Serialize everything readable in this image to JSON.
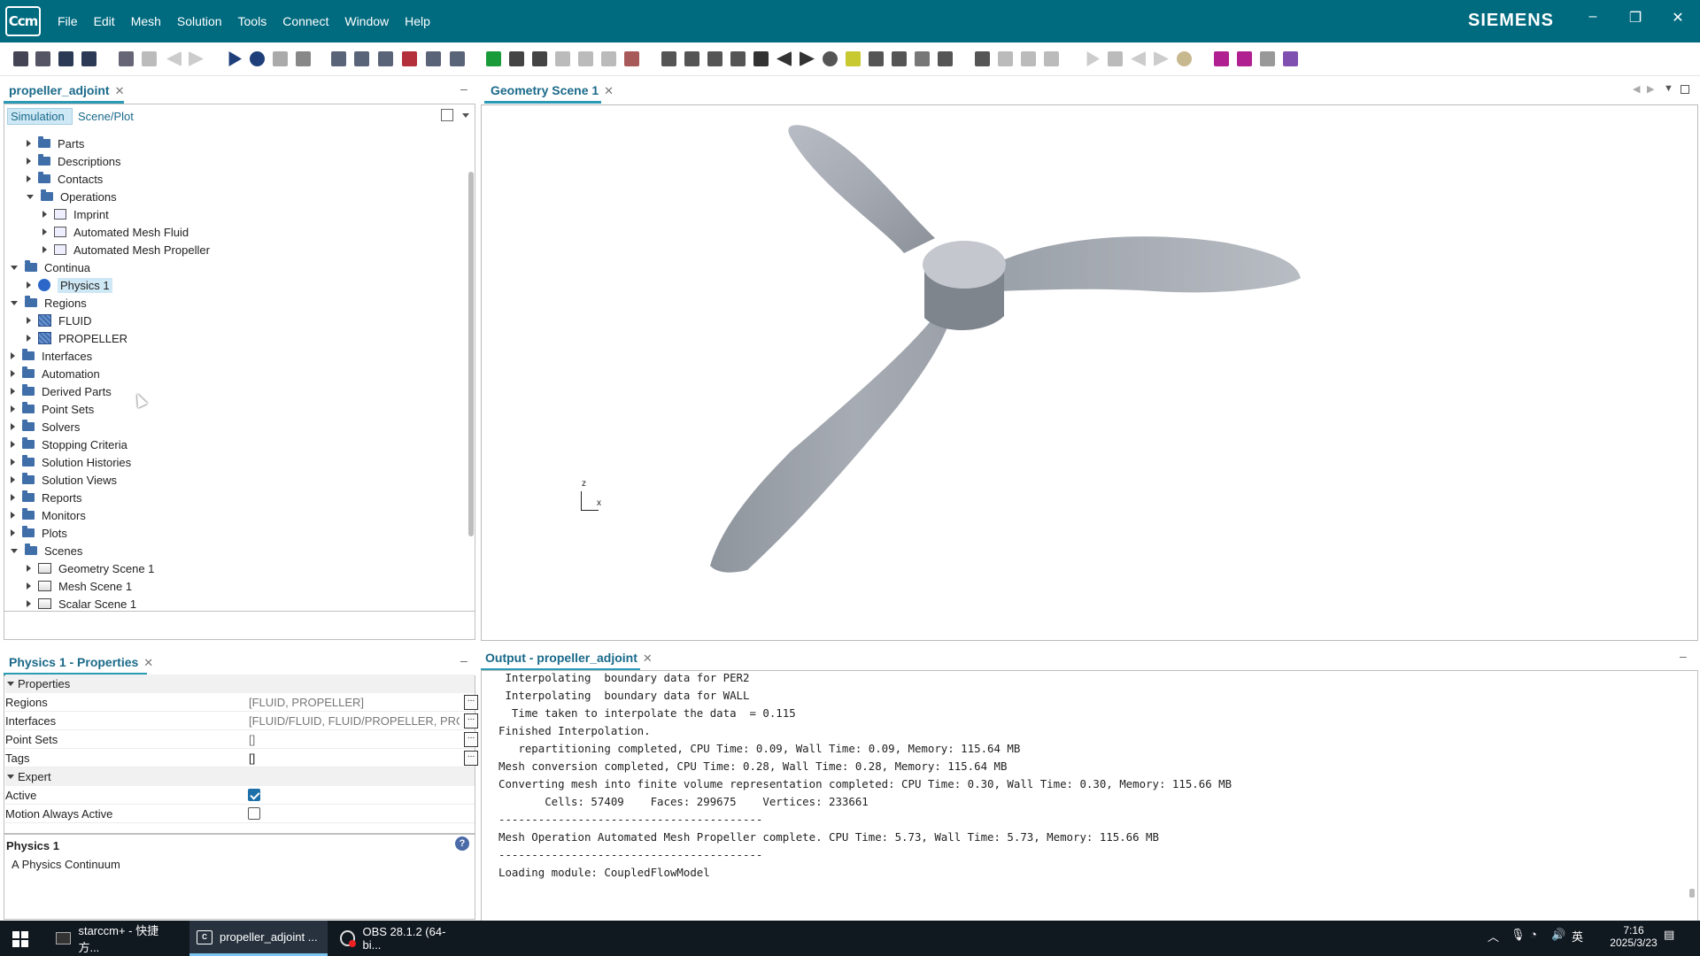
{
  "app": {
    "logo": "Ccm",
    "brand": "SIEMENS",
    "menu": [
      "File",
      "Edit",
      "Mesh",
      "Solution",
      "Tools",
      "Connect",
      "Window",
      "Help"
    ],
    "window_buttons": {
      "minimize": "–",
      "restore": "❐",
      "close": "✕"
    }
  },
  "left_panel": {
    "tab": "propeller_adjoint",
    "subtabs": [
      "Simulation",
      "Scene/Plot"
    ],
    "tree": [
      {
        "label": "Parts",
        "level": 1,
        "icon": "folder",
        "state": "collapsed"
      },
      {
        "label": "Descriptions",
        "level": 1,
        "icon": "folder",
        "state": "collapsed"
      },
      {
        "label": "Contacts",
        "level": 1,
        "icon": "folder",
        "state": "collapsed"
      },
      {
        "label": "Operations",
        "level": 1,
        "icon": "folder",
        "state": "expanded"
      },
      {
        "label": "Imprint",
        "level": 2,
        "icon": "operation",
        "state": "collapsed"
      },
      {
        "label": "Automated Mesh Fluid",
        "level": 2,
        "icon": "operation",
        "state": "collapsed"
      },
      {
        "label": "Automated Mesh Propeller",
        "level": 2,
        "icon": "operation",
        "state": "collapsed"
      },
      {
        "label": "Continua",
        "level": 0,
        "icon": "folder",
        "state": "expanded"
      },
      {
        "label": "Physics 1",
        "level": 1,
        "icon": "physics",
        "state": "collapsed",
        "selected": true
      },
      {
        "label": "Regions",
        "level": 0,
        "icon": "folder",
        "state": "expanded"
      },
      {
        "label": "FLUID",
        "level": 1,
        "icon": "region",
        "state": "collapsed"
      },
      {
        "label": "PROPELLER",
        "level": 1,
        "icon": "region",
        "state": "collapsed"
      },
      {
        "label": "Interfaces",
        "level": 0,
        "icon": "folder",
        "state": "collapsed"
      },
      {
        "label": "Automation",
        "level": 0,
        "icon": "folder",
        "state": "collapsed"
      },
      {
        "label": "Derived Parts",
        "level": 0,
        "icon": "folder",
        "state": "collapsed"
      },
      {
        "label": "Point Sets",
        "level": 0,
        "icon": "folder",
        "state": "collapsed"
      },
      {
        "label": "Solvers",
        "level": 0,
        "icon": "folder",
        "state": "collapsed"
      },
      {
        "label": "Stopping Criteria",
        "level": 0,
        "icon": "folder",
        "state": "collapsed"
      },
      {
        "label": "Solution Histories",
        "level": 0,
        "icon": "folder",
        "state": "collapsed"
      },
      {
        "label": "Solution Views",
        "level": 0,
        "icon": "folder",
        "state": "collapsed"
      },
      {
        "label": "Reports",
        "level": 0,
        "icon": "folder",
        "state": "collapsed"
      },
      {
        "label": "Monitors",
        "level": 0,
        "icon": "folder",
        "state": "collapsed"
      },
      {
        "label": "Plots",
        "level": 0,
        "icon": "folder",
        "state": "collapsed"
      },
      {
        "label": "Scenes",
        "level": 0,
        "icon": "folder",
        "state": "expanded"
      },
      {
        "label": "Geometry Scene 1",
        "level": 1,
        "icon": "scene",
        "state": "collapsed"
      },
      {
        "label": "Mesh Scene 1",
        "level": 1,
        "icon": "scene",
        "state": "collapsed"
      },
      {
        "label": "Scalar Scene 1",
        "level": 1,
        "icon": "scene",
        "state": "collapsed"
      }
    ]
  },
  "scene": {
    "tab": "Geometry Scene 1",
    "axis_z": "z",
    "axis_x": "x"
  },
  "properties": {
    "tab": "Physics 1 - Properties",
    "section1": "Properties",
    "section2": "Expert",
    "rows": [
      {
        "label": "Regions",
        "value": "[FLUID, PROPELLER]"
      },
      {
        "label": "Interfaces",
        "value": "[FLUID/FLUID, FLUID/PROPELLER, PRO..."
      },
      {
        "label": "Point Sets",
        "value": "[]"
      },
      {
        "label": "Tags",
        "value": "[]"
      }
    ],
    "expert_rows": [
      {
        "label": "Active",
        "checked": true
      },
      {
        "label": "Motion Always Active",
        "checked": false
      }
    ],
    "desc_title": "Physics 1",
    "desc_text": "A Physics Continuum",
    "help": "?"
  },
  "output": {
    "tab": "Output - propeller_adjoint",
    "lines": [
      " Interpolating  boundary data for PER2",
      " Interpolating  boundary data for WALL",
      "  Time taken to interpolate the data  = 0.115",
      "Finished Interpolation.",
      "   repartitioning completed, CPU Time: 0.09, Wall Time: 0.09, Memory: 115.64 MB",
      "Mesh conversion completed, CPU Time: 0.28, Wall Time: 0.28, Memory: 115.64 MB",
      "Converting mesh into finite volume representation completed: CPU Time: 0.30, Wall Time: 0.30, Memory: 115.66 MB",
      "       Cells: 57409    Faces: 299675    Vertices: 233661",
      "----------------------------------------",
      "Mesh Operation Automated Mesh Propeller complete. CPU Time: 5.73, Wall Time: 5.73, Memory: 115.66 MB",
      "----------------------------------------",
      "Loading module: CoupledFlowModel"
    ]
  },
  "taskbar": {
    "items": [
      "starccm+ - 快捷方...",
      "propeller_adjoint ...",
      "OBS 28.1.2 (64-bi..."
    ],
    "time": "7:16",
    "date": "2025/3/23",
    "ime": "英"
  }
}
